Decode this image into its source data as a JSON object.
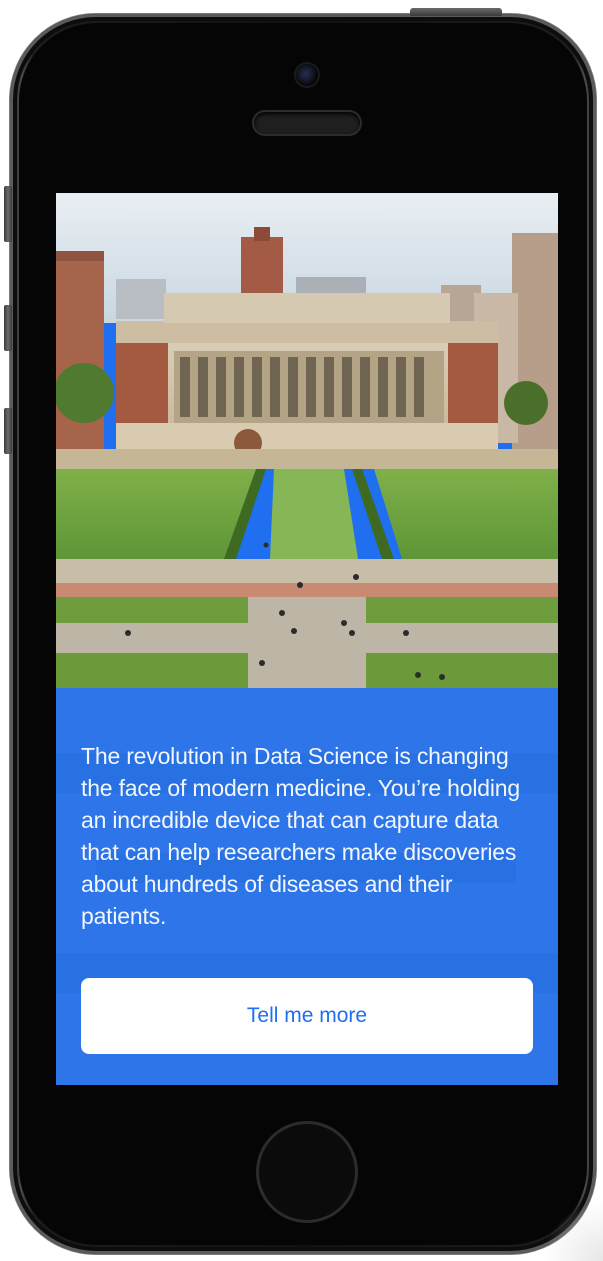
{
  "screen": {
    "intro_text": "The revolution in Data Science is changing the face of modern medicine. You’re holding an incredible device that can capture data that can help researchers make discoveries about hundreds of diseases and their patients.",
    "cta_label": "Tell me more"
  },
  "colors": {
    "accent_blue": "#1f6ff0",
    "button_bg": "#ffffff",
    "text_on_blue": "#f2f6ff"
  },
  "icons": {
    "camera": "camera-icon",
    "home": "home-button"
  }
}
